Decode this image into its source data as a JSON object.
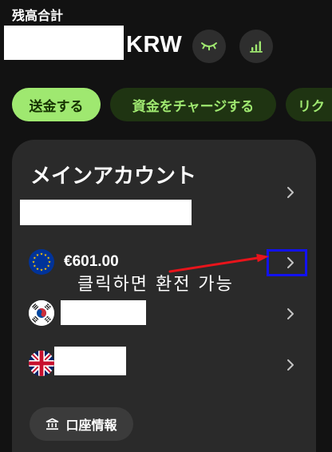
{
  "header": {
    "balance_label": "残高合計",
    "currency": "KRW",
    "hide_balance_icon": "eye-closed-icon",
    "insights_icon": "bar-chart-icon"
  },
  "actions": [
    {
      "label": "送金する"
    },
    {
      "label": "資金をチャージする"
    },
    {
      "label": "リク"
    }
  ],
  "account_card": {
    "title": "メインアカウント",
    "balances": [
      {
        "flag_icon": "eu-flag-icon",
        "amount": "€601.00"
      },
      {
        "flag_icon": "kr-flag-icon"
      },
      {
        "flag_icon": "gb-flag-icon"
      }
    ],
    "account_details_label": "口座情報",
    "account_details_icon": "bank-icon",
    "row_icon": "chevron-right-icon"
  },
  "annotation": {
    "text": "클릭하면 환전 가능",
    "arrow_icon": "red-arrow",
    "highlight": "blue-box"
  },
  "colors": {
    "background": "#121212",
    "card": "#2a2a2a",
    "accent": "#9fe870",
    "accent_dark": "#1f3412",
    "accent_text": "#163300",
    "annotation_red": "#e8141b",
    "annotation_blue": "#1212f0"
  }
}
